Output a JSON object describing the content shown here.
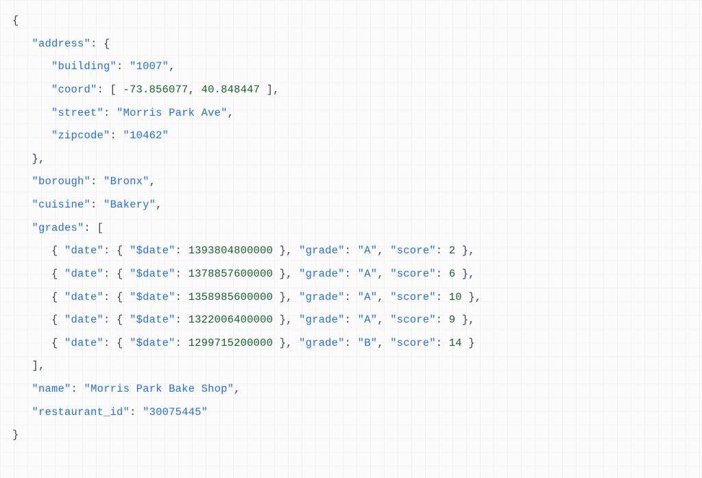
{
  "doc": {
    "address": {
      "building": "1007",
      "coord": [
        -73.856077,
        40.848447
      ],
      "street": "Morris Park Ave",
      "zipcode": "10462"
    },
    "borough": "Bronx",
    "cuisine": "Bakery",
    "grades": [
      {
        "date": {
          "$date": 1393804800000
        },
        "grade": "A",
        "score": 2
      },
      {
        "date": {
          "$date": 1378857600000
        },
        "grade": "A",
        "score": 6
      },
      {
        "date": {
          "$date": 1358985600000
        },
        "grade": "A",
        "score": 10
      },
      {
        "date": {
          "$date": 1322006400000
        },
        "grade": "A",
        "score": 9
      },
      {
        "date": {
          "$date": 1299715200000
        },
        "grade": "B",
        "score": 14
      }
    ],
    "name": "Morris Park Bake Shop",
    "restaurant_id": "30075445"
  }
}
